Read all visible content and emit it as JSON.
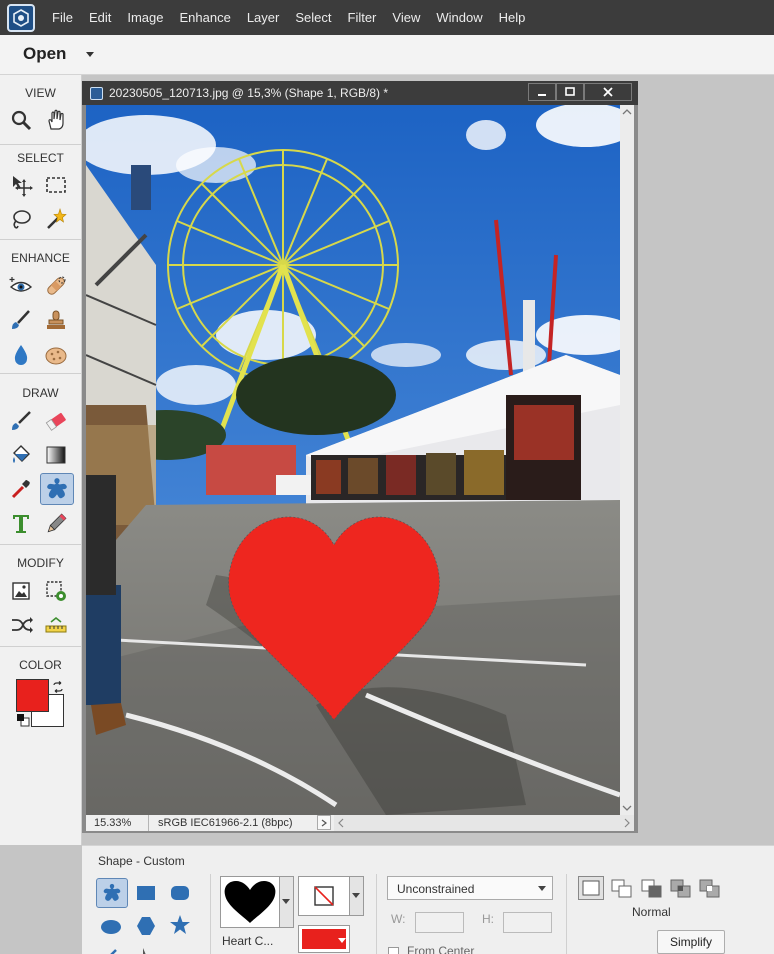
{
  "menubar": {
    "items": [
      "File",
      "Edit",
      "Image",
      "Enhance",
      "Layer",
      "Select",
      "Filter",
      "View",
      "Window",
      "Help"
    ]
  },
  "openbar": {
    "open_label": "Open"
  },
  "toolbox": {
    "sections": {
      "view": "VIEW",
      "select": "SELECT",
      "enhance": "ENHANCE",
      "draw": "DRAW",
      "modify": "MODIFY",
      "color": "COLOR"
    },
    "foreground_color": "#e8211d",
    "background_color": "#ffffff"
  },
  "document": {
    "title": "20230505_120713.jpg @ 15,3% (Shape 1, RGB/8) *",
    "zoom": "15.33%",
    "color_profile": "sRGB IEC61966-2.1 (8bpc)",
    "heart_color": "#ee261f"
  },
  "options": {
    "section_title": "Shape - Custom",
    "shape_name": "Heart C...",
    "shape_color": "#e8211d",
    "constraint": "Unconstrained",
    "w_label": "W:",
    "h_label": "H:",
    "w_value": "",
    "h_value": "",
    "from_center_label": "From Center",
    "mode_label": "Normal",
    "simplify_label": "Simplify"
  }
}
